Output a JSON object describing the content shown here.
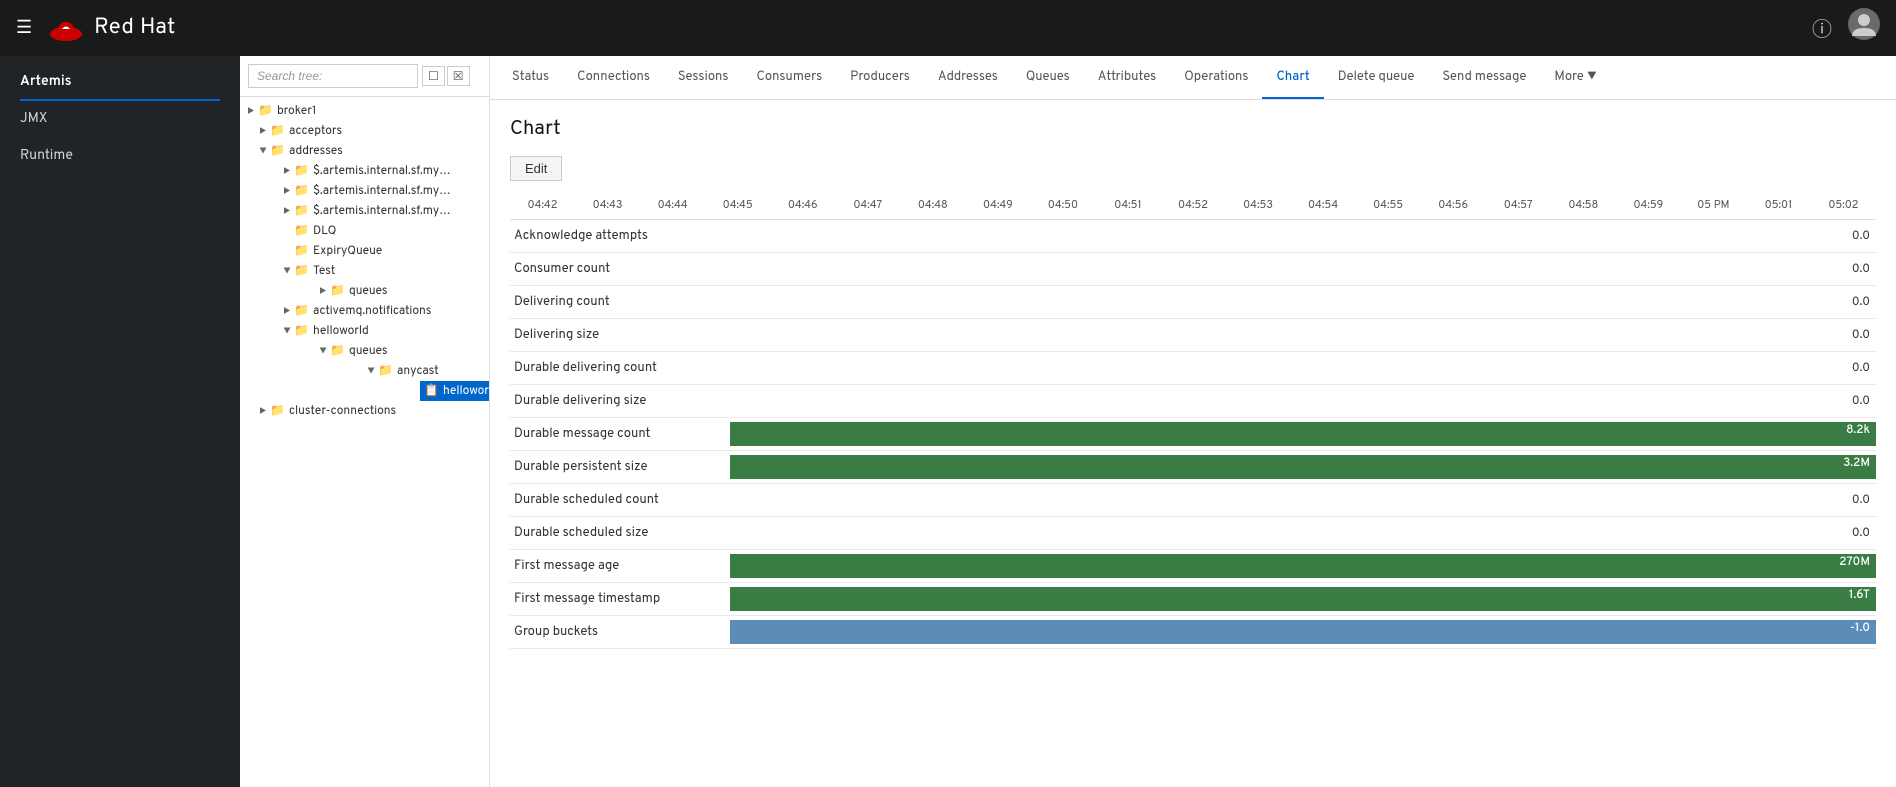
{
  "topnav": {
    "brand": "Red Hat",
    "help_icon": "?",
    "user_icon": "👤"
  },
  "sidebar": {
    "items": [
      {
        "id": "artemis",
        "label": "Artemis",
        "active": true
      },
      {
        "id": "jmx",
        "label": "JMX",
        "active": false
      },
      {
        "id": "runtime",
        "label": "Runtime",
        "active": false
      }
    ]
  },
  "tree": {
    "search_placeholder": "Search tree:",
    "nodes": [
      {
        "id": "broker1",
        "label": "broker1",
        "indent": 0,
        "toggle": "▶",
        "type": "folder"
      },
      {
        "id": "acceptors",
        "label": "acceptors",
        "indent": 1,
        "toggle": "▶",
        "type": "folder"
      },
      {
        "id": "addresses",
        "label": "addresses",
        "indent": 1,
        "toggle": "▼",
        "type": "folder"
      },
      {
        "id": "artemis1",
        "label": "$.artemis.internal.sf.my-cluster....",
        "indent": 2,
        "toggle": "▶",
        "type": "folder"
      },
      {
        "id": "artemis2",
        "label": "$.artemis.internal.sf.my-cluster....",
        "indent": 2,
        "toggle": "▶",
        "type": "folder"
      },
      {
        "id": "artemis3",
        "label": "$.artemis.internal.sf.my-cluster....",
        "indent": 2,
        "toggle": "▶",
        "type": "folder"
      },
      {
        "id": "dlq",
        "label": "DLQ",
        "indent": 2,
        "toggle": "",
        "type": "folder"
      },
      {
        "id": "expiryqueue",
        "label": "ExpiryQueue",
        "indent": 2,
        "toggle": "",
        "type": "folder"
      },
      {
        "id": "test",
        "label": "Test",
        "indent": 2,
        "toggle": "▼",
        "type": "folder"
      },
      {
        "id": "queues-test",
        "label": "queues",
        "indent": 3,
        "toggle": "▶",
        "type": "folder"
      },
      {
        "id": "activemq",
        "label": "activemq.notifications",
        "indent": 2,
        "toggle": "▶",
        "type": "folder"
      },
      {
        "id": "helloworld-addr",
        "label": "helloworld",
        "indent": 2,
        "toggle": "▼",
        "type": "folder"
      },
      {
        "id": "queues-hw",
        "label": "queues",
        "indent": 3,
        "toggle": "▼",
        "type": "folder"
      },
      {
        "id": "anycast",
        "label": "anycast",
        "indent": 4,
        "toggle": "▼",
        "type": "folder"
      },
      {
        "id": "helloworld-node",
        "label": "helloworld",
        "indent": 5,
        "toggle": "",
        "type": "leaf",
        "selected": true
      }
    ],
    "cluster_connections": {
      "label": "cluster-connections",
      "indent": 0,
      "toggle": "▶",
      "type": "folder"
    }
  },
  "tabs": [
    {
      "id": "status",
      "label": "Status",
      "active": false
    },
    {
      "id": "connections",
      "label": "Connections",
      "active": false
    },
    {
      "id": "sessions",
      "label": "Sessions",
      "active": false
    },
    {
      "id": "consumers",
      "label": "Consumers",
      "active": false
    },
    {
      "id": "producers",
      "label": "Producers",
      "active": false
    },
    {
      "id": "addresses",
      "label": "Addresses",
      "active": false
    },
    {
      "id": "queues",
      "label": "Queues",
      "active": false
    },
    {
      "id": "attributes",
      "label": "Attributes",
      "active": false
    },
    {
      "id": "operations",
      "label": "Operations",
      "active": false
    },
    {
      "id": "chart",
      "label": "Chart",
      "active": true
    },
    {
      "id": "delete-queue",
      "label": "Delete queue",
      "active": false
    },
    {
      "id": "send-message",
      "label": "Send message",
      "active": false
    },
    {
      "id": "more",
      "label": "More ▾",
      "active": false
    }
  ],
  "chart": {
    "title": "Chart",
    "edit_label": "Edit",
    "timeline": [
      "04:42",
      "04:43",
      "04:44",
      "04:45",
      "04:46",
      "04:47",
      "04:48",
      "04:49",
      "04:50",
      "04:51",
      "04:52",
      "04:53",
      "04:54",
      "04:55",
      "04:56",
      "04:57",
      "04:58",
      "04:59",
      "05 PM",
      "05:01",
      "05:02"
    ],
    "metrics": [
      {
        "id": "acknowledge-attempts",
        "label": "Acknowledge attempts",
        "value": "0.0",
        "bar_color": null,
        "bar_pct": 0
      },
      {
        "id": "consumer-count",
        "label": "Consumer count",
        "value": "0.0",
        "bar_color": null,
        "bar_pct": 0
      },
      {
        "id": "delivering-count",
        "label": "Delivering count",
        "value": "0.0",
        "bar_color": null,
        "bar_pct": 0
      },
      {
        "id": "delivering-size",
        "label": "Delivering size",
        "value": "0.0",
        "bar_color": null,
        "bar_pct": 0
      },
      {
        "id": "durable-delivering-count",
        "label": "Durable delivering count",
        "value": "0.0",
        "bar_color": null,
        "bar_pct": 0
      },
      {
        "id": "durable-delivering-size",
        "label": "Durable delivering size",
        "value": "0.0",
        "bar_color": null,
        "bar_pct": 0
      },
      {
        "id": "durable-message-count",
        "label": "Durable message count",
        "value": "8.2k",
        "bar_color": "#3a7d44",
        "bar_pct": 100,
        "bar_label": "8.2k"
      },
      {
        "id": "durable-persistent-size",
        "label": "Durable persistent size",
        "value": "3.2M",
        "bar_color": "#3a7d44",
        "bar_pct": 100,
        "bar_label": "3.2M"
      },
      {
        "id": "durable-scheduled-count",
        "label": "Durable scheduled count",
        "value": "0.0",
        "bar_color": null,
        "bar_pct": 0
      },
      {
        "id": "durable-scheduled-size",
        "label": "Durable scheduled size",
        "value": "0.0",
        "bar_color": null,
        "bar_pct": 0
      },
      {
        "id": "first-message-age",
        "label": "First message age",
        "value": "270M",
        "bar_color": "#3a7d44",
        "bar_pct": 100,
        "bar_label": "270M"
      },
      {
        "id": "first-message-timestamp",
        "label": "First message timestamp",
        "value": "1.6T",
        "bar_color": "#3a7d44",
        "bar_pct": 100,
        "bar_label": "1.6T"
      },
      {
        "id": "group-buckets",
        "label": "Group buckets",
        "value": "-1.0",
        "bar_color": "#5b8db8",
        "bar_pct": 100,
        "bar_label": "-1.0"
      }
    ]
  }
}
